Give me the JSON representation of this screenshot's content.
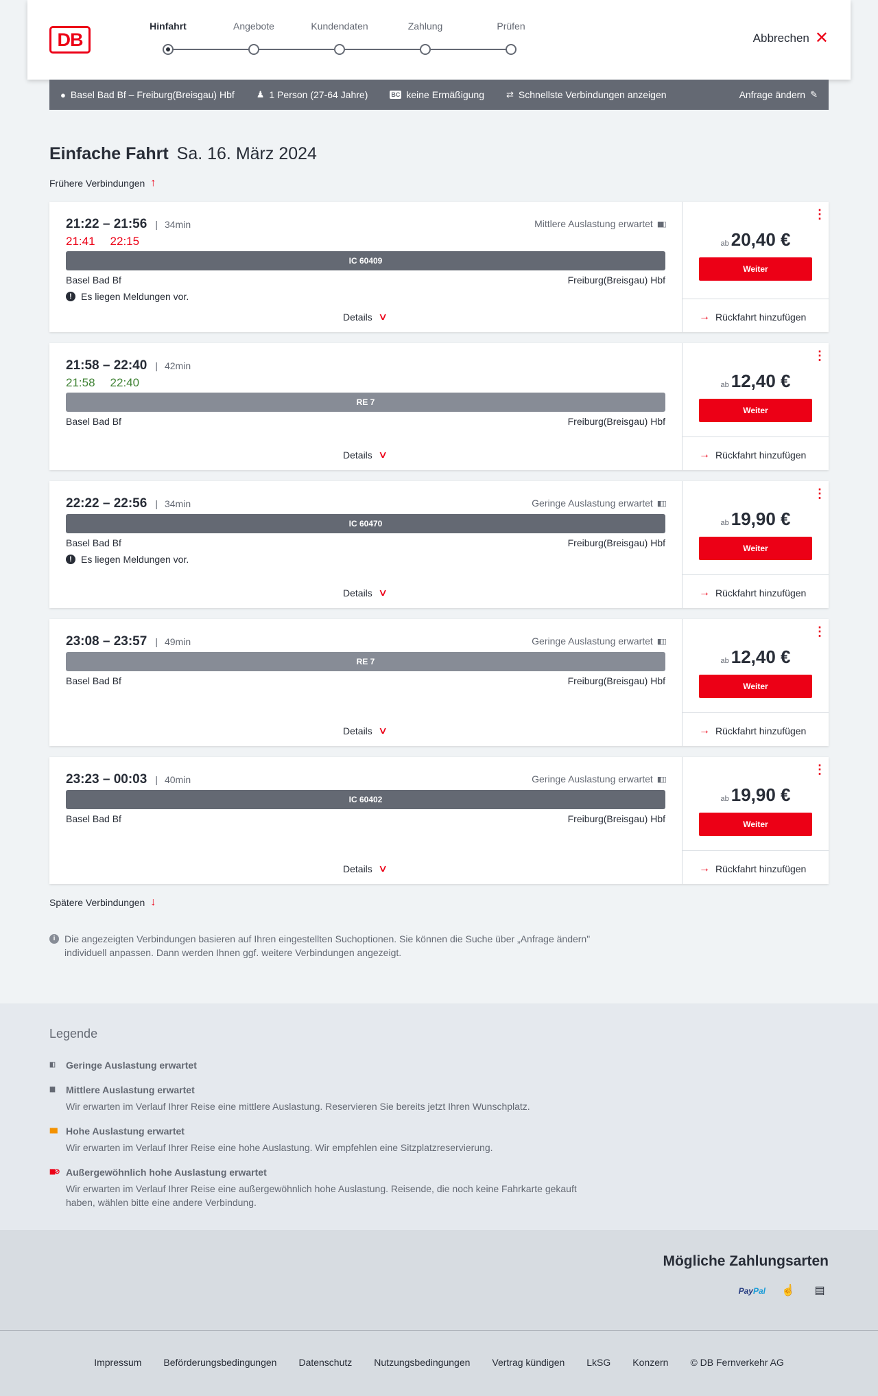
{
  "header": {
    "logo": "DB",
    "steps": [
      {
        "label": "Hinfahrt",
        "active": true
      },
      {
        "label": "Angebote",
        "active": false
      },
      {
        "label": "Kundendaten",
        "active": false
      },
      {
        "label": "Zahlung",
        "active": false
      },
      {
        "label": "Prüfen",
        "active": false
      }
    ],
    "cancel_label": "Abbrechen"
  },
  "search": {
    "route": "Basel Bad Bf – Freiburg(Breisgau) Hbf",
    "persons": "1 Person (27-64 Jahre)",
    "bahncard_badge": "BC",
    "discount": "keine Ermäßigung",
    "option": "Schnellste Verbindungen anzeigen",
    "edit_label": "Anfrage ändern"
  },
  "title": {
    "main": "Einfache Fahrt",
    "date": "Sa. 16. März 2024"
  },
  "earlier_label": "Frühere Verbindungen",
  "later_label": "Spätere Verbindungen",
  "connections": [
    {
      "times": "21:22 – 21:56",
      "duration": "34min",
      "rt_dep": "21:41",
      "rt_arr": "22:15",
      "load": "Mittlere Auslastung erwartet",
      "train": "IC 60409",
      "from": "Basel Bad Bf",
      "to": "Freiburg(Breisgau) Hbf",
      "message": "Es liegen Meldungen vor.",
      "details": "Details",
      "price_prefix": "ab",
      "price": "20,40 €",
      "button": "Weiter",
      "return": "Rückfahrt hinzufügen"
    },
    {
      "times": "21:58 – 22:40",
      "duration": "42min",
      "rt_dep": "21:58",
      "rt_arr": "22:40",
      "load": "",
      "train": "RE 7",
      "from": "Basel Bad Bf",
      "to": "Freiburg(Breisgau) Hbf",
      "message": "",
      "details": "Details",
      "price_prefix": "ab",
      "price": "12,40 €",
      "button": "Weiter",
      "return": "Rückfahrt hinzufügen"
    },
    {
      "times": "22:22 – 22:56",
      "duration": "34min",
      "load": "Geringe Auslastung erwartet",
      "train": "IC 60470",
      "from": "Basel Bad Bf",
      "to": "Freiburg(Breisgau) Hbf",
      "message": "Es liegen Meldungen vor.",
      "details": "Details",
      "price_prefix": "ab",
      "price": "19,90 €",
      "button": "Weiter",
      "return": "Rückfahrt hinzufügen"
    },
    {
      "times": "23:08 – 23:57",
      "duration": "49min",
      "load": "Geringe Auslastung erwartet",
      "train": "RE 7",
      "from": "Basel Bad Bf",
      "to": "Freiburg(Breisgau) Hbf",
      "message": "",
      "details": "Details",
      "price_prefix": "ab",
      "price": "12,40 €",
      "button": "Weiter",
      "return": "Rückfahrt hinzufügen"
    },
    {
      "times": "23:23 – 00:03",
      "duration": "40min",
      "load": "Geringe Auslastung erwartet",
      "train": "IC 60402",
      "from": "Basel Bad Bf",
      "to": "Freiburg(Breisgau) Hbf",
      "message": "",
      "details": "Details",
      "price_prefix": "ab",
      "price": "19,90 €",
      "button": "Weiter",
      "return": "Rückfahrt hinzufügen"
    }
  ],
  "info_text": "Die angezeigten Verbindungen basieren auf Ihren eingestellten Suchoptionen. Sie können die Suche über „Anfrage ändern\" individuell anpassen. Dann werden Ihnen ggf. weitere Verbindungen angezeigt.",
  "legend": {
    "title": "Legende",
    "items": [
      {
        "title": "Geringe Auslastung erwartet",
        "desc": ""
      },
      {
        "title": "Mittlere Auslastung erwartet",
        "desc": "Wir erwarten im Verlauf Ihrer Reise eine mittlere Auslastung. Reservieren Sie bereits jetzt Ihren Wunschplatz."
      },
      {
        "title": "Hohe Auslastung erwartet",
        "desc": "Wir erwarten im Verlauf Ihrer Reise eine hohe Auslastung. Wir empfehlen eine Sitzplatzreservierung."
      },
      {
        "title": "Außergewöhnlich hohe Auslastung erwartet",
        "desc": "Wir erwarten im Verlauf Ihrer Reise eine außergewöhnlich hohe Auslastung. Reisende, die noch keine Fahrkarte gekauft haben, wählen bitte eine andere Verbindung."
      }
    ]
  },
  "payment": {
    "title": "Mögliche Zahlungsarten",
    "paypal_a": "Pay",
    "paypal_b": "Pal"
  },
  "footer": [
    "Impressum",
    "Beförderungsbedingungen",
    "Datenschutz",
    "Nutzungsbedingungen",
    "Vertrag kündigen",
    "LkSG",
    "Konzern",
    "© DB Fernverkehr AG"
  ],
  "colors": {
    "accent": "#ec0016",
    "late": "#ec0016",
    "ontime": "#408335",
    "bar_ic": "#646973",
    "bar_re": "#878c96",
    "high_load": "#f39200"
  },
  "icons": [
    "close-icon",
    "location-pin-icon",
    "person-icon",
    "bahncard-icon",
    "swap-icon",
    "pencil-icon",
    "arrow-up-icon",
    "arrow-down-icon",
    "occupancy-icon",
    "alert-icon",
    "chevron-down-icon",
    "kebab-menu-icon",
    "arrow-right-icon",
    "info-icon"
  ]
}
